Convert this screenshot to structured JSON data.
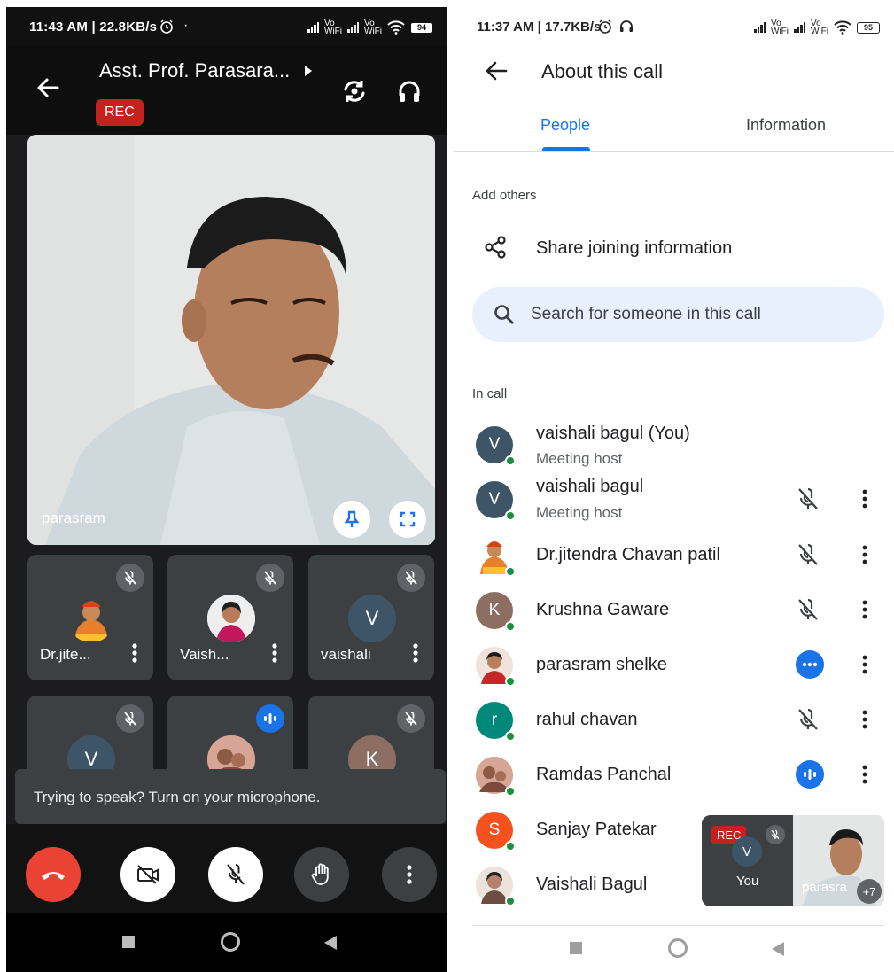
{
  "left": {
    "status": {
      "time_speed": "11:43 AM | 22.8KB/s",
      "dot": "·",
      "vo_label": "Vo",
      "wifi_label": "WiFi",
      "battery": "94"
    },
    "header": {
      "title": "Asst. Prof. Parasara...",
      "rec_label": "REC"
    },
    "main_video": {
      "name": "parasram"
    },
    "tiles": [
      {
        "label": "Dr.jite...",
        "avatar_letter": "",
        "muted": true
      },
      {
        "label": "Vaish...",
        "avatar_letter": "",
        "muted": true
      },
      {
        "label": "vaishali",
        "avatar_letter": "V",
        "muted": true
      },
      {
        "label": "",
        "avatar_letter": "V",
        "muted": true
      },
      {
        "label": "",
        "avatar_letter": "",
        "muted": false
      },
      {
        "label": "",
        "avatar_letter": "K",
        "muted": true
      }
    ],
    "toast": "Trying to speak? Turn on your microphone."
  },
  "right": {
    "status": {
      "time_speed": "11:37 AM | 17.7KB/s",
      "vo_label": "Vo",
      "wifi_label": "WiFi",
      "battery": "95"
    },
    "header": {
      "title": "About this call"
    },
    "tabs": {
      "people": "People",
      "information": "Information"
    },
    "add_others_label": "Add others",
    "share_label": "Share joining information",
    "search_placeholder": "Search for someone in this call",
    "in_call_label": "In call",
    "people": [
      {
        "name": "vaishali bagul (You)",
        "role": "Meeting host",
        "letter": "V",
        "color": "#3d5566",
        "mic": "none"
      },
      {
        "name": "vaishali bagul",
        "role": "Meeting host",
        "letter": "V",
        "color": "#3d5566",
        "mic": "muted"
      },
      {
        "name": "Dr.jitendra Chavan patil",
        "role": "",
        "letter": "",
        "color": "#ffffff",
        "mic": "muted"
      },
      {
        "name": "Krushna Gaware",
        "role": "",
        "letter": "K",
        "color": "#8d6e63",
        "mic": "muted"
      },
      {
        "name": "parasram shelke",
        "role": "",
        "letter": "",
        "color": "#c6b0a0",
        "mic": "more"
      },
      {
        "name": "rahul chavan",
        "role": "",
        "letter": "r",
        "color": "#00897b",
        "mic": "muted"
      },
      {
        "name": "Ramdas Panchal",
        "role": "",
        "letter": "",
        "color": "#b98a7a",
        "mic": "speaking"
      },
      {
        "name": "Sanjay Patekar",
        "role": "",
        "letter": "S",
        "color": "#f4511e",
        "mic": "none"
      },
      {
        "name": "Vaishali Bagul",
        "role": "",
        "letter": "",
        "color": "#b7a191",
        "mic": "none"
      }
    ],
    "pip": {
      "rec_label": "REC",
      "you_letter": "V",
      "you_label": "You",
      "video_label": "parasra",
      "plus_count": "+7"
    }
  }
}
